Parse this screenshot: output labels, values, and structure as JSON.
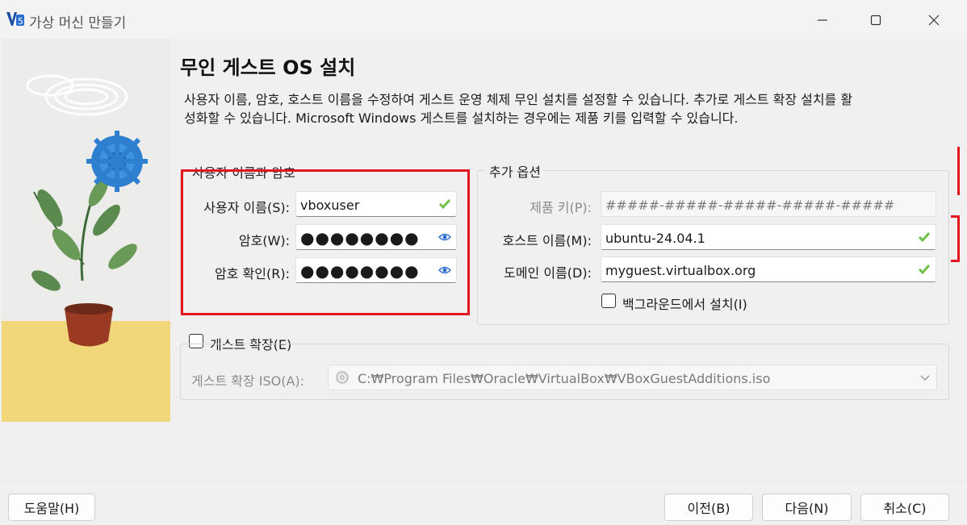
{
  "window": {
    "title": "가상 머신 만들기"
  },
  "page": {
    "title": "무인 게스트 OS 설치",
    "description": "사용자 이름, 암호, 호스트 이름을 수정하여 게스트 운영 체제 무인 설치를 설정할 수 있습니다. 추가로 게스트 확장 설치를 활성화할 수 있습니다. Microsoft Windows 게스트를 설치하는 경우에는 제품 키를 입력할 수 있습니다."
  },
  "credentials": {
    "group_title": "사용자 이름과 암호",
    "username_label": "사용자 이름(S):",
    "username_value": "vboxuser",
    "password_label": "암호(W):",
    "password_value": "●●●●●●●●",
    "confirm_label": "암호 확인(R):",
    "confirm_value": "●●●●●●●●"
  },
  "options": {
    "group_title": "추가 옵션",
    "product_key_label": "제품 키(P):",
    "product_key_value": "#####-#####-#####-#####-#####",
    "hostname_label": "호스트 이름(M):",
    "hostname_value": "ubuntu-24.04.1",
    "domain_label": "도메인 이름(D):",
    "domain_value": "myguest.virtualbox.org",
    "background_install_label": "백그라운드에서 설치(I)",
    "background_install_checked": false
  },
  "guest_additions": {
    "checkbox_label": "게스트 확장(E)",
    "checked": false,
    "iso_label": "게스트 확장 ISO(A):",
    "iso_path": "C:₩Program Files₩Oracle₩VirtualBox₩VBoxGuestAdditions.iso"
  },
  "buttons": {
    "help": "도움말(H)",
    "back": "이전(B)",
    "next": "다음(N)",
    "cancel": "취소(C)"
  },
  "icons": {
    "valid": "check-icon",
    "reveal": "eye-icon",
    "disc": "disc-icon",
    "dropdown": "chevron-down-icon"
  },
  "colors": {
    "highlight": "#e3151f",
    "valid_check": "#6cc24a",
    "eye": "#2f6fd0"
  }
}
